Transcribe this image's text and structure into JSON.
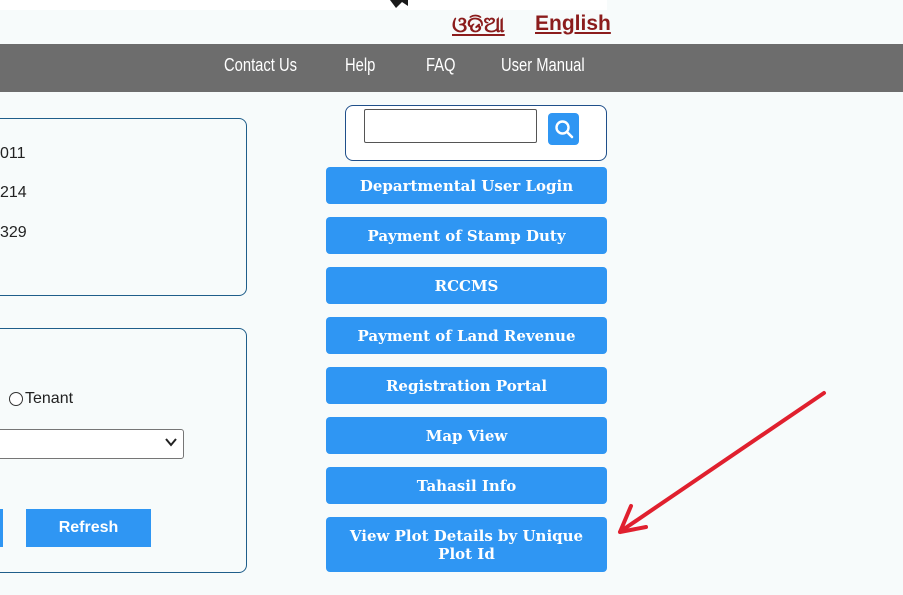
{
  "header": {
    "lang_odia": "ଓଡିଆ",
    "lang_english": "English"
  },
  "nav": {
    "items": [
      "Contact Us",
      "Help",
      "FAQ",
      "User Manual"
    ]
  },
  "stats": {
    "values": [
      "011",
      "214",
      "329"
    ]
  },
  "search_form": {
    "radio_tenant_label": "Tenant",
    "select_value": "",
    "refresh_label": "Refresh"
  },
  "search": {
    "value": "",
    "placeholder": ""
  },
  "side_buttons": [
    "Departmental User Login",
    "Payment of Stamp Duty",
    "RCCMS",
    "Payment of Land Revenue",
    "Registration Portal",
    "Map View",
    "Tahasil Info",
    "View Plot Details by Unique Plot Id"
  ],
  "colors": {
    "nav_bg": "#6d6d6d",
    "button_blue": "#2f96f3",
    "lang_link": "#8b1c1c",
    "panel_border": "#1f5e8a",
    "arrow_red": "#e0202e"
  },
  "icons": {
    "search": "magnifier-icon",
    "select": "chevron-down-icon",
    "annotation": "red-arrow-icon"
  }
}
